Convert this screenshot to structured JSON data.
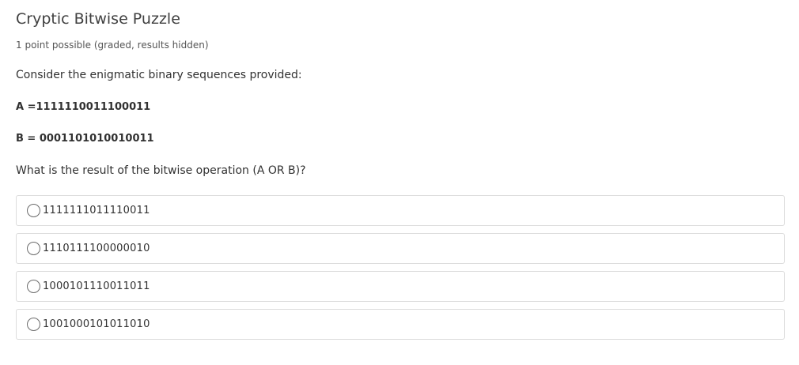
{
  "problem": {
    "title": "Cryptic Bitwise Puzzle",
    "points": "1 point possible (graded, results hidden)",
    "prompt": "Consider the enigmatic binary sequences provided:",
    "seq_a": "A =1111110011100011",
    "seq_b": "B = 0001101010010011",
    "question": "What is the result of the bitwise operation (A OR B)?",
    "choices": [
      {
        "label": "1111111011110011",
        "selected": false
      },
      {
        "label": "1110111100000010",
        "selected": false
      },
      {
        "label": "1000101110011011",
        "selected": false
      },
      {
        "label": "1001000101011010",
        "selected": false
      }
    ]
  }
}
